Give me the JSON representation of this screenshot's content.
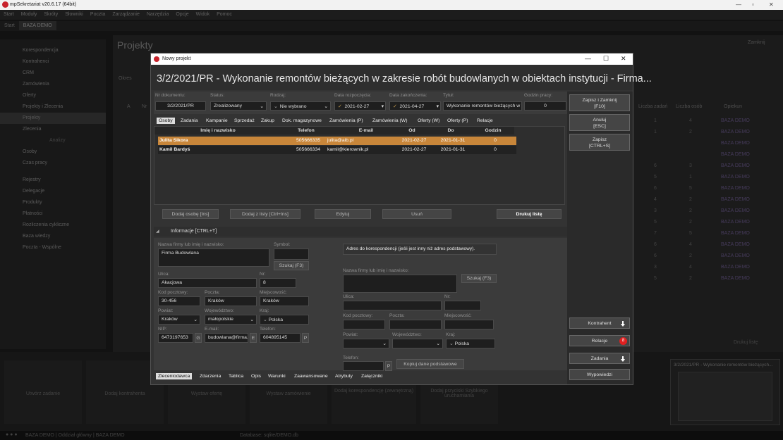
{
  "window": {
    "title": "mpSekretariat v20.6.17 (64bit)"
  },
  "menu": [
    "Start",
    "Moduły",
    "Skróty",
    "Słowniki",
    "Poczta",
    "Zarządzanie",
    "Narzędzia",
    "Opcje",
    "Widok",
    "Pomoc"
  ],
  "tabs": [
    "Start",
    "BAZA DEMO"
  ],
  "nav": [
    "Korespondencja",
    "Kontrahenci",
    "CRM",
    "Zamówienia",
    "Oferty",
    "Projekty i Zlecenia",
    "Projekty",
    "Zlecenia",
    "Analizy",
    "Osoby",
    "Czas pracy",
    "Rejestry",
    "Delegacje",
    "Produkty",
    "Płatności",
    "Rozliczenia cykliczne",
    "Baza wiedzy",
    "Poczta - Wspólne"
  ],
  "background": {
    "title": "Projekty",
    "close": "Zamknij",
    "col_zadan": "Liczba zadań",
    "col_osob": "Liczba osób",
    "col_opiekun": "Opiekun",
    "col_a": "A",
    "col_nr": "Nr",
    "search_lbl": "Okres",
    "bgbutton": "Drukuj listę",
    "db": "BAZA DEMO",
    "rows": [
      {
        "z": "1",
        "o": "4"
      },
      {
        "z": "1",
        "o": "2"
      },
      {
        "z": "",
        "o": ""
      },
      {
        "z": "",
        "o": ""
      },
      {
        "z": "6",
        "o": "3"
      },
      {
        "z": "5",
        "o": "1"
      },
      {
        "z": "6",
        "o": "5"
      },
      {
        "z": "4",
        "o": "2"
      },
      {
        "z": "3",
        "o": "2"
      },
      {
        "z": "5",
        "o": "2"
      },
      {
        "z": "7",
        "o": "5"
      },
      {
        "z": "6",
        "o": "4"
      },
      {
        "z": "6",
        "o": "2"
      },
      {
        "z": "3",
        "o": "4"
      },
      {
        "z": "5",
        "o": "2"
      }
    ]
  },
  "bottom_tiles": [
    "Utwórz zadanie",
    "Dodaj kontrahenta",
    "Wystaw ofertę",
    "Wystaw zamówienie",
    "Dodaj korespondencję (zewnętrzną)",
    "Dodaj przyciski Szybkiego uruchamiania"
  ],
  "preview_title": "3/2/2021/PR - Wykonanie remontów bieżących...",
  "status": {
    "left": "BAZA DEMO | Oddział główny | BAZA DEMO",
    "mid": "Database: sqlite/DEMO.db"
  },
  "dialog": {
    "title": "Nowy projekt",
    "header": "3/2/2021/PR - Wykonanie remontów bieżących w zakresie robót budowlanych w obiektach instytucji - Firma...",
    "f": {
      "nr_lbl": "Nr dokumentu:",
      "nr": "3/2/2021/PR",
      "status_lbl": "Status:",
      "status": "Zrealizowany",
      "rodzaj_lbl": "Rodzaj:",
      "rodzaj": "Nie wybrano",
      "start_lbl": "Data rozpoczęcia:",
      "start": "2021-02-27",
      "end_lbl": "Data zakończenia:",
      "end": "2021-04-27",
      "tytul_lbl": "Tytuł:",
      "tytul": "Wykonanie remontów bieżących w",
      "godz_lbl": "Godzin pracy:",
      "godz": "0"
    },
    "tabs": [
      "Osoby",
      "Zadania",
      "Kampanie",
      "Sprzedaż",
      "Zakup",
      "Dok. magazynowe",
      "Zamówienia (P)",
      "Zamówienia (W)",
      "Oferty (W)",
      "Oferty (P)",
      "Relacje"
    ],
    "grid_headers": [
      "Imię i nazwisko",
      "Telefon",
      "E-mail",
      "Od",
      "Do",
      "Godzin"
    ],
    "rows": [
      {
        "name": "Julita Sikora",
        "tel": "505666335",
        "mail": "julita@aib.pl",
        "od": "2021-02-27",
        "do": "2021-01-31",
        "godz": "0"
      },
      {
        "name": "Kamil Bardyś",
        "tel": "505666334",
        "mail": "kamil@kierownik.pl",
        "od": "2021-02-27",
        "do": "2021-01-31",
        "godz": "0"
      }
    ],
    "grid_buttons": [
      "Dodaj osobę [Ins]",
      "Dodaj z listy [Ctrl+Ins]",
      "Edytuj",
      "Usuń",
      "Drukuj listę"
    ],
    "info_label": "Informacje [CTRL+T]",
    "info": {
      "nazwa_lbl": "Nazwa firmy lub imię i nazwisko:",
      "nazwa": "Firma Budowlana",
      "symbol_lbl": "Symbol:",
      "szukaj": "Szukaj (F3)",
      "ulica_lbl": "Ulica:",
      "ulica": "Akacjowa",
      "nr_lbl": "Nr:",
      "nr": "8",
      "kod_lbl": "Kod pocztowy:",
      "kod": "30-456",
      "poczta_lbl": "Poczta:",
      "poczta": "Kraków",
      "miejsc_lbl": "Miejscowość:",
      "miejsc": "Kraków",
      "powiat_lbl": "Powiat:",
      "powiat": "Kraków",
      "woj_lbl": "Województwo:",
      "woj": "małopolskie",
      "kraj_lbl": "Kraj:",
      "kraj": "Polska",
      "nip_lbl": "NIP:",
      "nip": "6473197653",
      "nip_btn": "G",
      "email_lbl": "E-mail:",
      "email": "budowlana@firma.",
      "email_btn": "E",
      "tel_lbl": "Telefon:",
      "tel": "604895145",
      "tel_btn": "P"
    },
    "addr": {
      "header": "Adres do korespondencji (jeśli jest inny niż adres podstawowy).",
      "nazwa_lbl": "Nazwa firmy lub imię i nazwisko:",
      "szukaj": "Szukaj (F3)",
      "ulica_lbl": "Ulica:",
      "nr_lbl": "Nr:",
      "kod_lbl": "Kod pocztowy:",
      "poczta_lbl": "Poczta:",
      "miejsc_lbl": "Miejscowość:",
      "powiat_lbl": "Powiat:",
      "woj_lbl": "Województwo:",
      "kraj_lbl": "Kraj:",
      "kraj": "Polska",
      "tel_lbl": "Telefon:",
      "tel_btn": "P",
      "copy_btn": "Kopiuj dane podstawowe"
    },
    "bottom_tabs": [
      "Zleceniodawca",
      "Zdarzenia",
      "Tablica",
      "Opis",
      "Warunki",
      "Zaawansowane",
      "Atrybuty",
      "Załączniki"
    ],
    "right": {
      "save_close": "Zapisz i Zamknij\n[F10]",
      "cancel": "Anuluj\n[ESC]",
      "save": "Zapisz\n[CTRL+S]",
      "kontrahent": "Kontrahent",
      "relacje": "Relacje",
      "badge": "8",
      "zadania": "Zadania",
      "wypowiedzi": "Wypowiedzi"
    }
  },
  "colors": {
    "accent": "#c8863a",
    "badge": "#e02020"
  }
}
